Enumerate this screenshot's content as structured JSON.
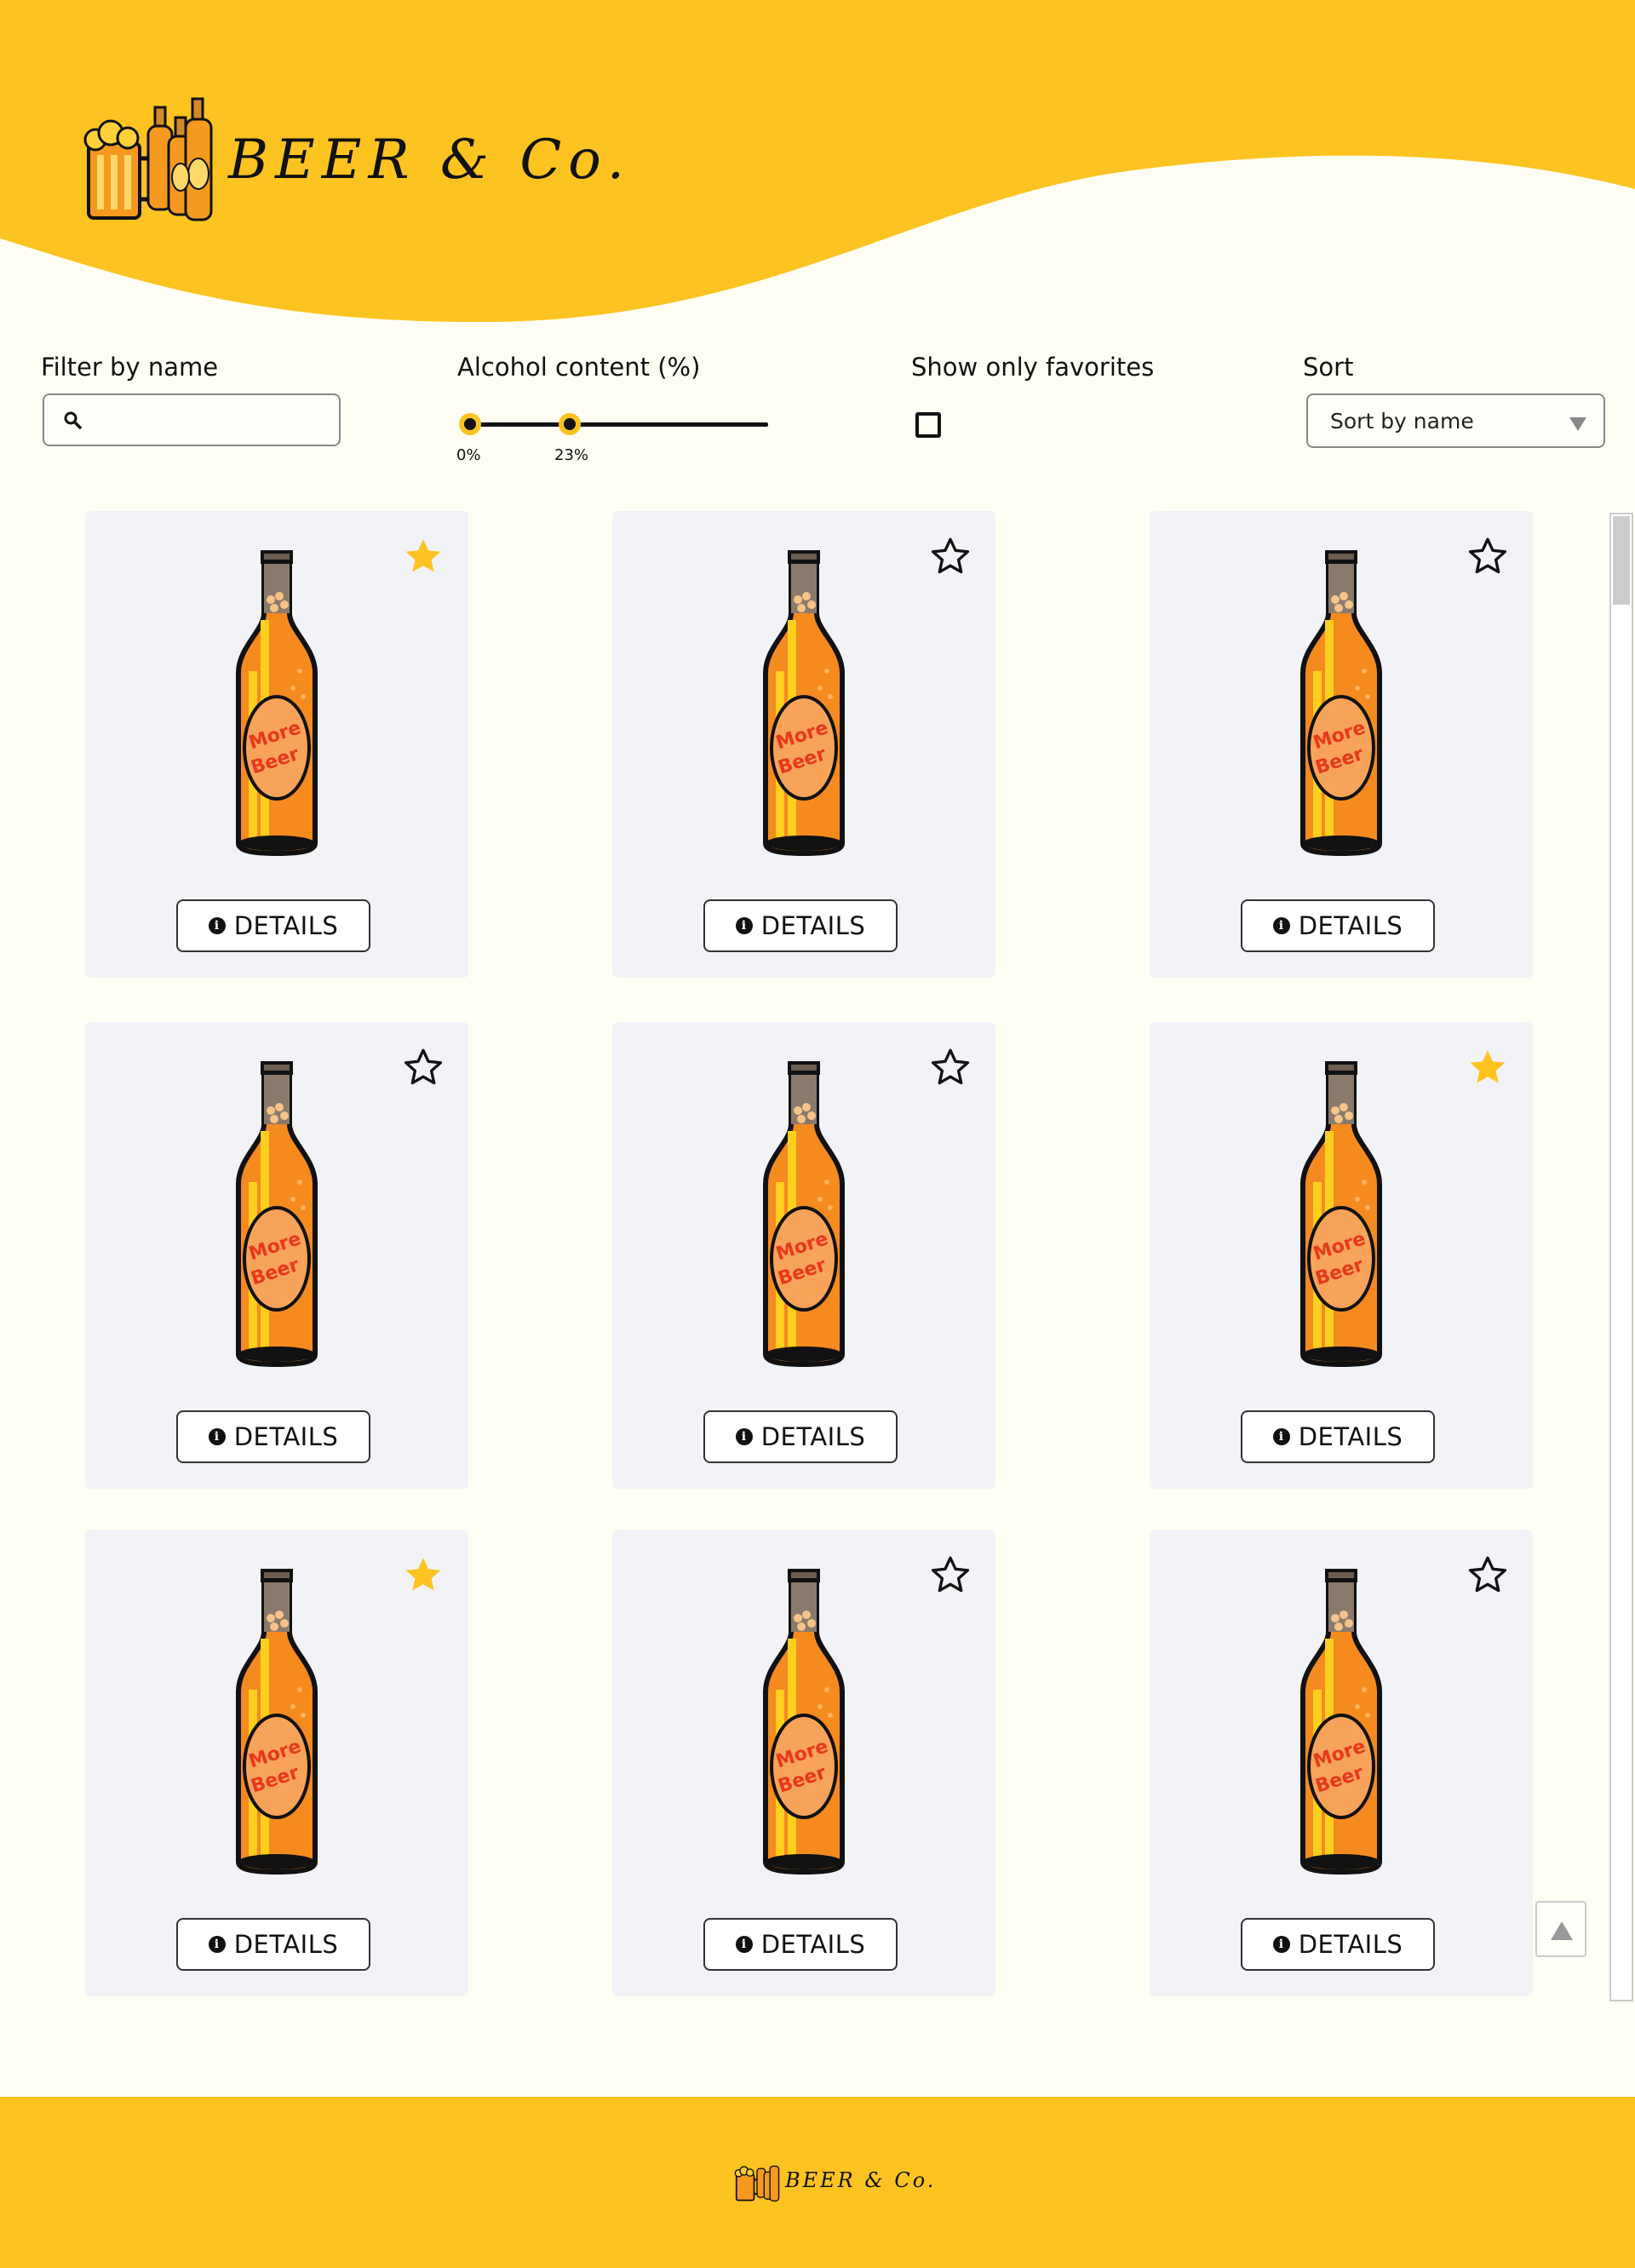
{
  "brand": {
    "name": "BEER & Co.",
    "colors": {
      "primary": "#fdc321",
      "background": "#fffef4",
      "card": "#f2f3f7"
    },
    "logo_icon": "beer-logo-icon"
  },
  "filters": {
    "name_label": "Filter by name",
    "name_value": "",
    "alcohol_label": "Alcohol content (%)",
    "alcohol_min_label": "0%",
    "alcohol_max_label": "23%",
    "alcohol_min": 0,
    "alcohol_max": 23,
    "favorites_label": "Show only favorites",
    "favorites_checked": false,
    "sort_label": "Sort",
    "sort_value": "Sort by name"
  },
  "products": [
    {
      "favorite": true,
      "button_label": "DETAILS",
      "image": "beer-bottle-icon"
    },
    {
      "favorite": false,
      "button_label": "DETAILS",
      "image": "beer-bottle-icon"
    },
    {
      "favorite": false,
      "button_label": "DETAILS",
      "image": "beer-bottle-icon"
    },
    {
      "favorite": false,
      "button_label": "DETAILS",
      "image": "beer-bottle-icon"
    },
    {
      "favorite": false,
      "button_label": "DETAILS",
      "image": "beer-bottle-icon"
    },
    {
      "favorite": true,
      "button_label": "DETAILS",
      "image": "beer-bottle-icon"
    },
    {
      "favorite": true,
      "button_label": "DETAILS",
      "image": "beer-bottle-icon"
    },
    {
      "favorite": false,
      "button_label": "DETAILS",
      "image": "beer-bottle-icon"
    },
    {
      "favorite": false,
      "button_label": "DETAILS",
      "image": "beer-bottle-icon"
    }
  ],
  "bottle_label_text": "More Beer",
  "scroll_to_top_icon": "arrow-up-icon"
}
